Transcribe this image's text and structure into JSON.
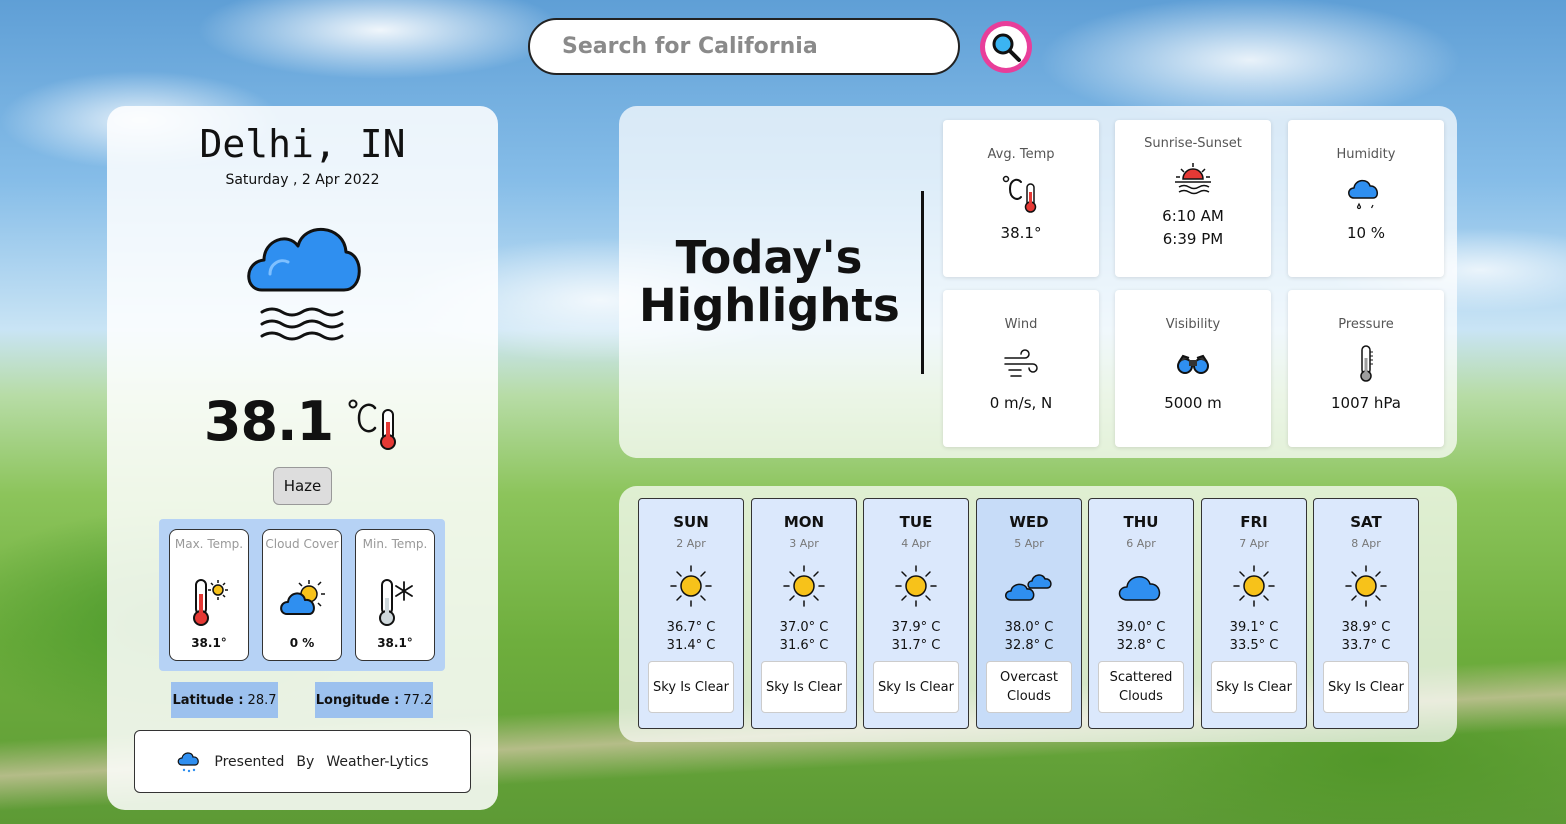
{
  "search": {
    "placeholder": "Search for California"
  },
  "current": {
    "city": "Delhi,  IN",
    "date": "Saturday , 2 Apr 2022",
    "temperature": "38.1",
    "condition": "Haze",
    "stats": [
      {
        "label": "Max. Temp.",
        "value": "38.1°",
        "icon": "hot-thermometer-icon"
      },
      {
        "label": "Cloud Cover",
        "value": "0 %",
        "icon": "partly-cloudy-icon"
      },
      {
        "label": "Min. Temp.",
        "value": "38.1°",
        "icon": "cold-thermometer-icon"
      }
    ],
    "latitude_label": "Latitude :",
    "latitude": "28.7",
    "longitude_label": "Longitude :",
    "longitude": "77.2"
  },
  "footer": {
    "presented": "Presented",
    "by": "By",
    "brand": "Weather-Lytics"
  },
  "highlights": {
    "title_line1": "Today's",
    "title_line2": "Highlights",
    "cards": [
      {
        "label": "Avg. Temp",
        "value": "38.1°",
        "icon": "thermometer-celsius-icon"
      },
      {
        "label": "Sunrise-Sunset",
        "sunrise": "6:10 AM",
        "sunset": "6:39 PM",
        "icon": "sunset-icon"
      },
      {
        "label": "Humidity",
        "value": "10 %",
        "icon": "rain-cloud-icon"
      },
      {
        "label": "Wind",
        "value": "0 m/s, N",
        "icon": "wind-icon"
      },
      {
        "label": "Visibility",
        "value": "5000 m",
        "icon": "binoculars-icon"
      },
      {
        "label": "Pressure",
        "value": "1007 hPa",
        "icon": "pressure-gauge-icon"
      }
    ]
  },
  "forecast": [
    {
      "day": "SUN",
      "date": "2 Apr",
      "high": "36.7° C",
      "low": "31.4° C",
      "desc": "Sky Is Clear",
      "icon": "sun-icon"
    },
    {
      "day": "MON",
      "date": "3 Apr",
      "high": "37.0° C",
      "low": "31.6° C",
      "desc": "Sky Is Clear",
      "icon": "sun-icon"
    },
    {
      "day": "TUE",
      "date": "4 Apr",
      "high": "37.9° C",
      "low": "31.7° C",
      "desc": "Sky Is Clear",
      "icon": "sun-icon"
    },
    {
      "day": "WED",
      "date": "5 Apr",
      "high": "38.0° C",
      "low": "32.8° C",
      "desc": "Overcast Clouds",
      "icon": "clouds-icon"
    },
    {
      "day": "THU",
      "date": "6 Apr",
      "high": "39.0° C",
      "low": "32.8° C",
      "desc": "Scattered Clouds",
      "icon": "cloud-icon"
    },
    {
      "day": "FRI",
      "date": "7 Apr",
      "high": "39.1° C",
      "low": "33.5° C",
      "desc": "Sky Is Clear",
      "icon": "sun-icon"
    },
    {
      "day": "SAT",
      "date": "8 Apr",
      "high": "38.9° C",
      "low": "33.7° C",
      "desc": "Sky Is Clear",
      "icon": "sun-icon"
    }
  ],
  "colors": {
    "accent": "#e83e9a",
    "cloud_blue": "#2f8ff0",
    "sun_yellow": "#f7c21a",
    "panel_blue": "#b6d2f5",
    "coord_blue": "#9cc1ee"
  }
}
